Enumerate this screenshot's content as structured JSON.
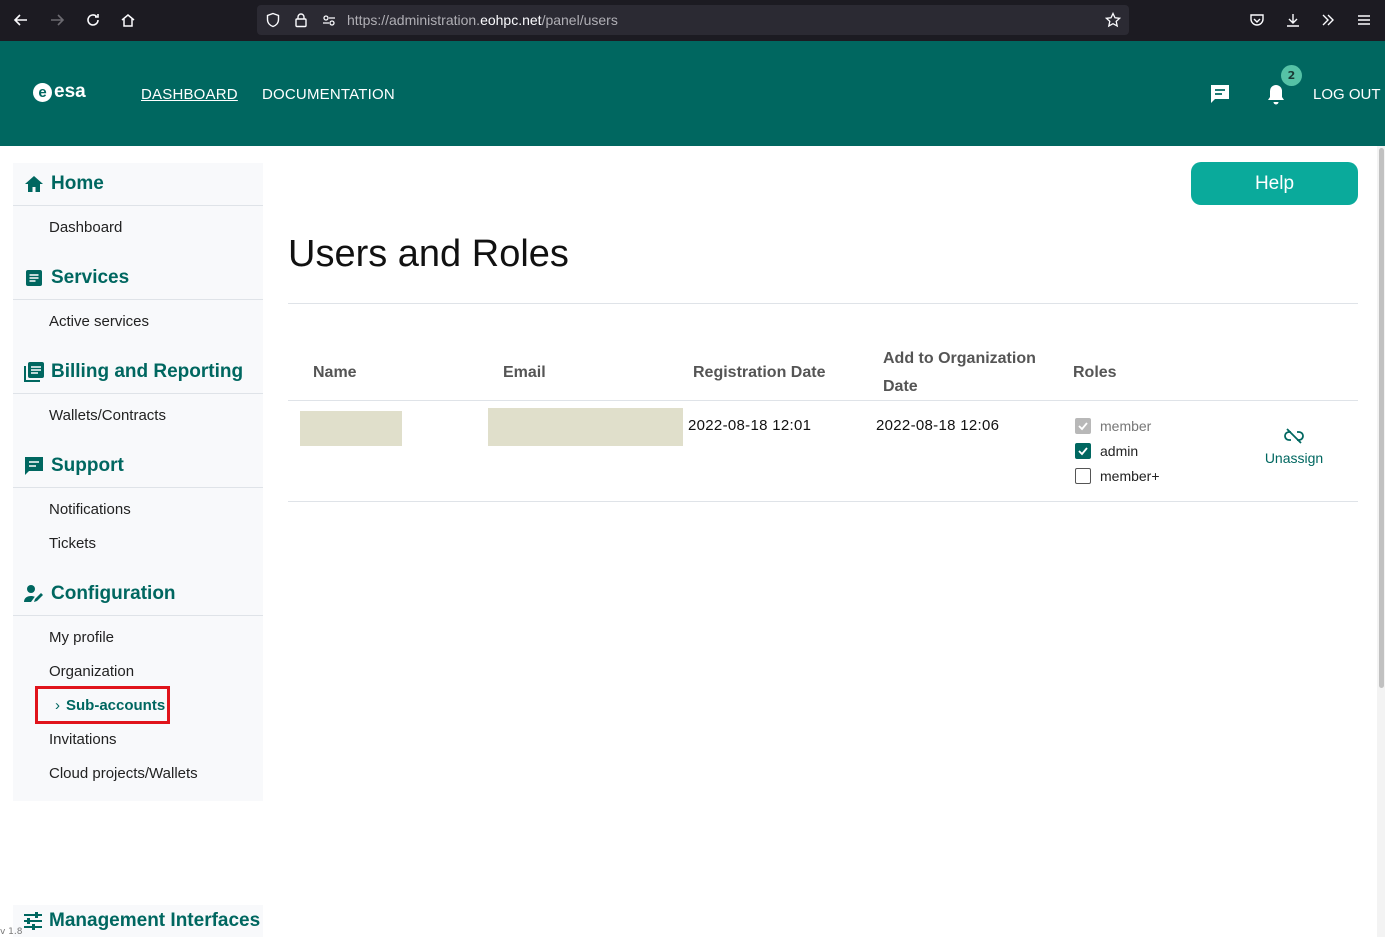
{
  "browser": {
    "url_prefix": "https://administration.",
    "url_domain": "eohpc.net",
    "url_path": "/panel/users"
  },
  "header": {
    "logo_text": "esa",
    "logo_mark": "e",
    "nav": [
      {
        "label": "DASHBOARD"
      },
      {
        "label": "DOCUMENTATION"
      }
    ],
    "notification_count": "2",
    "logout_label": "LOG OUT"
  },
  "sidebar": {
    "sections": [
      {
        "title": "Home",
        "icon": "home-icon",
        "items": [
          "Dashboard"
        ]
      },
      {
        "title": "Services",
        "icon": "list-icon",
        "items": [
          "Active services"
        ]
      },
      {
        "title": "Billing and Reporting",
        "icon": "library-icon",
        "items": [
          "Wallets/Contracts"
        ]
      },
      {
        "title": "Support",
        "icon": "message-icon",
        "items": [
          "Notifications",
          "Tickets"
        ]
      },
      {
        "title": "Configuration",
        "icon": "user-edit-icon",
        "items": [
          "My profile",
          "Organization",
          "Sub-accounts",
          "Invitations",
          "Cloud projects/Wallets"
        ]
      }
    ],
    "active_item": "Sub-accounts",
    "management_title": "Management Interfaces",
    "version": "v 1.8"
  },
  "main": {
    "help_label": "Help",
    "title": "Users and Roles",
    "table": {
      "headers": {
        "name": "Name",
        "email": "Email",
        "registration": "Registration Date",
        "add_org_line1": "Add to Organization",
        "add_org_line2": "Date",
        "roles": "Roles"
      },
      "rows": [
        {
          "registration_date": "2022-08-18 12:01",
          "add_date": "2022-08-18 12:06",
          "roles": [
            {
              "label": "member",
              "checked": true,
              "disabled": true
            },
            {
              "label": "admin",
              "checked": true,
              "disabled": false
            },
            {
              "label": "member+",
              "checked": false,
              "disabled": false
            }
          ],
          "action_label": "Unassign"
        }
      ]
    }
  },
  "colors": {
    "brand": "#006760",
    "help_button": "#0aaa9b",
    "highlight": "#e0141b"
  }
}
